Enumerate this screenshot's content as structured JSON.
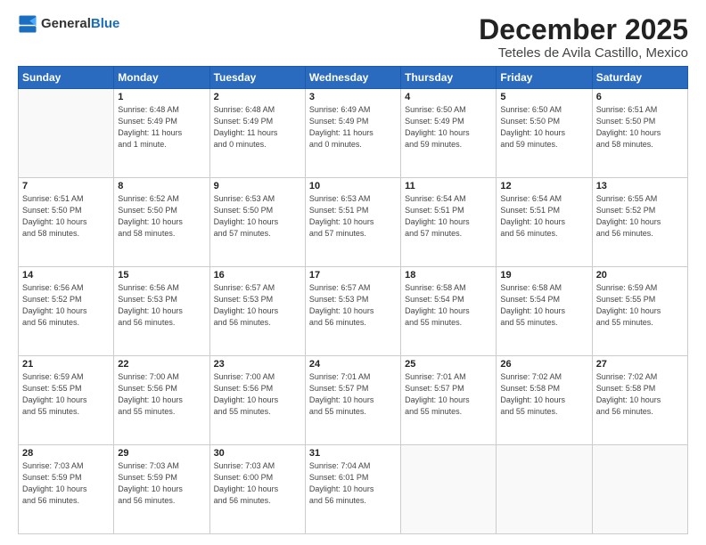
{
  "logo": {
    "general": "General",
    "blue": "Blue"
  },
  "title": "December 2025",
  "subtitle": "Teteles de Avila Castillo, Mexico",
  "days_header": [
    "Sunday",
    "Monday",
    "Tuesday",
    "Wednesday",
    "Thursday",
    "Friday",
    "Saturday"
  ],
  "weeks": [
    [
      {
        "day": "",
        "info": ""
      },
      {
        "day": "1",
        "info": "Sunrise: 6:48 AM\nSunset: 5:49 PM\nDaylight: 11 hours\nand 1 minute."
      },
      {
        "day": "2",
        "info": "Sunrise: 6:48 AM\nSunset: 5:49 PM\nDaylight: 11 hours\nand 0 minutes."
      },
      {
        "day": "3",
        "info": "Sunrise: 6:49 AM\nSunset: 5:49 PM\nDaylight: 11 hours\nand 0 minutes."
      },
      {
        "day": "4",
        "info": "Sunrise: 6:50 AM\nSunset: 5:49 PM\nDaylight: 10 hours\nand 59 minutes."
      },
      {
        "day": "5",
        "info": "Sunrise: 6:50 AM\nSunset: 5:50 PM\nDaylight: 10 hours\nand 59 minutes."
      },
      {
        "day": "6",
        "info": "Sunrise: 6:51 AM\nSunset: 5:50 PM\nDaylight: 10 hours\nand 58 minutes."
      }
    ],
    [
      {
        "day": "7",
        "info": "Sunrise: 6:51 AM\nSunset: 5:50 PM\nDaylight: 10 hours\nand 58 minutes."
      },
      {
        "day": "8",
        "info": "Sunrise: 6:52 AM\nSunset: 5:50 PM\nDaylight: 10 hours\nand 58 minutes."
      },
      {
        "day": "9",
        "info": "Sunrise: 6:53 AM\nSunset: 5:50 PM\nDaylight: 10 hours\nand 57 minutes."
      },
      {
        "day": "10",
        "info": "Sunrise: 6:53 AM\nSunset: 5:51 PM\nDaylight: 10 hours\nand 57 minutes."
      },
      {
        "day": "11",
        "info": "Sunrise: 6:54 AM\nSunset: 5:51 PM\nDaylight: 10 hours\nand 57 minutes."
      },
      {
        "day": "12",
        "info": "Sunrise: 6:54 AM\nSunset: 5:51 PM\nDaylight: 10 hours\nand 56 minutes."
      },
      {
        "day": "13",
        "info": "Sunrise: 6:55 AM\nSunset: 5:52 PM\nDaylight: 10 hours\nand 56 minutes."
      }
    ],
    [
      {
        "day": "14",
        "info": "Sunrise: 6:56 AM\nSunset: 5:52 PM\nDaylight: 10 hours\nand 56 minutes."
      },
      {
        "day": "15",
        "info": "Sunrise: 6:56 AM\nSunset: 5:53 PM\nDaylight: 10 hours\nand 56 minutes."
      },
      {
        "day": "16",
        "info": "Sunrise: 6:57 AM\nSunset: 5:53 PM\nDaylight: 10 hours\nand 56 minutes."
      },
      {
        "day": "17",
        "info": "Sunrise: 6:57 AM\nSunset: 5:53 PM\nDaylight: 10 hours\nand 56 minutes."
      },
      {
        "day": "18",
        "info": "Sunrise: 6:58 AM\nSunset: 5:54 PM\nDaylight: 10 hours\nand 55 minutes."
      },
      {
        "day": "19",
        "info": "Sunrise: 6:58 AM\nSunset: 5:54 PM\nDaylight: 10 hours\nand 55 minutes."
      },
      {
        "day": "20",
        "info": "Sunrise: 6:59 AM\nSunset: 5:55 PM\nDaylight: 10 hours\nand 55 minutes."
      }
    ],
    [
      {
        "day": "21",
        "info": "Sunrise: 6:59 AM\nSunset: 5:55 PM\nDaylight: 10 hours\nand 55 minutes."
      },
      {
        "day": "22",
        "info": "Sunrise: 7:00 AM\nSunset: 5:56 PM\nDaylight: 10 hours\nand 55 minutes."
      },
      {
        "day": "23",
        "info": "Sunrise: 7:00 AM\nSunset: 5:56 PM\nDaylight: 10 hours\nand 55 minutes."
      },
      {
        "day": "24",
        "info": "Sunrise: 7:01 AM\nSunset: 5:57 PM\nDaylight: 10 hours\nand 55 minutes."
      },
      {
        "day": "25",
        "info": "Sunrise: 7:01 AM\nSunset: 5:57 PM\nDaylight: 10 hours\nand 55 minutes."
      },
      {
        "day": "26",
        "info": "Sunrise: 7:02 AM\nSunset: 5:58 PM\nDaylight: 10 hours\nand 55 minutes."
      },
      {
        "day": "27",
        "info": "Sunrise: 7:02 AM\nSunset: 5:58 PM\nDaylight: 10 hours\nand 56 minutes."
      }
    ],
    [
      {
        "day": "28",
        "info": "Sunrise: 7:03 AM\nSunset: 5:59 PM\nDaylight: 10 hours\nand 56 minutes."
      },
      {
        "day": "29",
        "info": "Sunrise: 7:03 AM\nSunset: 5:59 PM\nDaylight: 10 hours\nand 56 minutes."
      },
      {
        "day": "30",
        "info": "Sunrise: 7:03 AM\nSunset: 6:00 PM\nDaylight: 10 hours\nand 56 minutes."
      },
      {
        "day": "31",
        "info": "Sunrise: 7:04 AM\nSunset: 6:01 PM\nDaylight: 10 hours\nand 56 minutes."
      },
      {
        "day": "",
        "info": ""
      },
      {
        "day": "",
        "info": ""
      },
      {
        "day": "",
        "info": ""
      }
    ]
  ]
}
